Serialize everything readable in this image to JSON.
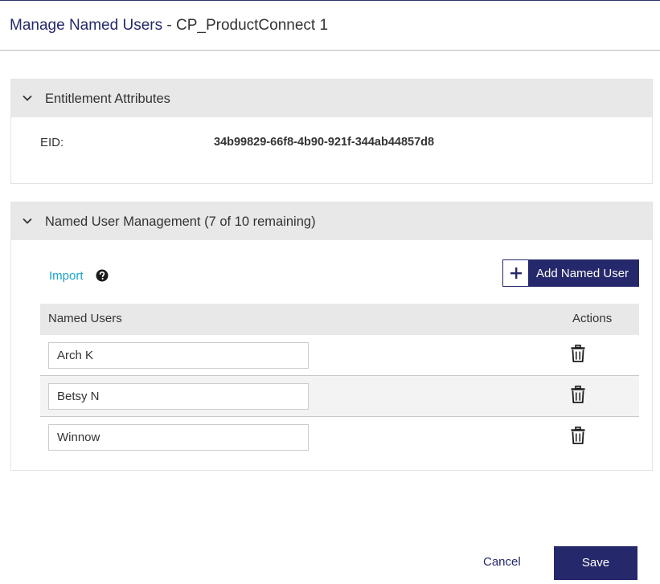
{
  "header": {
    "title": "Manage Named Users",
    "separator": " - ",
    "product": "CP_ProductConnect 1"
  },
  "entitlement": {
    "section_title": "Entitlement Attributes",
    "eid_label": "EID:",
    "eid_value": "34b99829-66f8-4b90-921f-344ab44857d8"
  },
  "named_users": {
    "section_title": "Named User Management (7 of 10 remaining)",
    "import_label": "Import",
    "add_label": "Add Named User",
    "columns": [
      "Named Users",
      "Actions"
    ],
    "users": [
      "Arch K",
      "Betsy N",
      "Winnow"
    ]
  },
  "footer": {
    "cancel_label": "Cancel",
    "save_label": "Save"
  },
  "colors": {
    "primary": "#25286a",
    "link": "#1aa3c9",
    "section_header_bg": "#e8e8e8"
  },
  "icons": [
    "chevron-down-icon",
    "help-icon",
    "plus-icon",
    "trash-icon"
  ]
}
